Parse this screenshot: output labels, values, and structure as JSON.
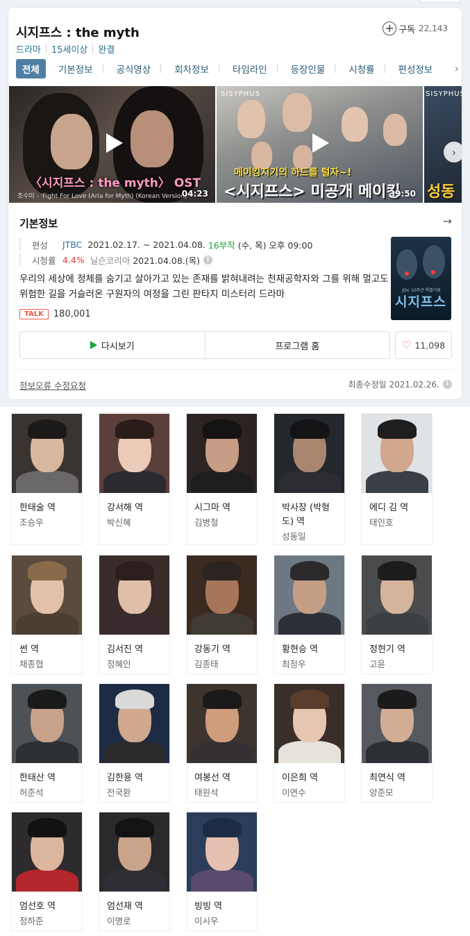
{
  "header": {
    "title": "시지프스 : the myth",
    "subscribe_label": "구독",
    "subscribe_count": "22,143",
    "meta": [
      "드라마",
      "15세이상",
      "완결"
    ]
  },
  "tabs": [
    "전체",
    "기본정보",
    "공식영상",
    "회차정보",
    "타임라인",
    "등장인물",
    "시청률",
    "편성정보"
  ],
  "videos": [
    {
      "caption": "〈시지프스 : the myth〉 OST",
      "subtitle": "조수미 - 'Fight For Love (Aria for Myth) (Korean Version)'",
      "duration": "04:23"
    },
    {
      "logo": "SISYPHUS",
      "caption_top": "메이킹지기의 하드를 털자~!",
      "caption_main": "<시지프스> 미공개 메이킹",
      "duration": "39:50"
    },
    {
      "logo": "SISYPHUS",
      "caption_main": "성동"
    }
  ],
  "basic_info": {
    "section_title": "기본정보",
    "broadcast_label": "편성",
    "channel": "JTBC",
    "period": "2021.02.17. ~ 2021.04.08.",
    "episodes": "16부작",
    "schedule": "(수, 목) 오후 09:00",
    "rating_label": "시청률",
    "rating": "4.4%",
    "rating_source": "닐슨코리아",
    "rating_date": "2021.04.08.(목)",
    "description": "우리의 세상에 정체를 숨기고 살아가고 있는 존재를 밝혀내려는 천재공학자와 그를 위해 멀고도 위험한 길을 거슬러온 구원자의 여정을 그린 판타지 미스터리 드라마",
    "talk_badge": "TALK",
    "talk_count": "180,001",
    "poster_title": "시지프스",
    "poster_small": "jtbc 10주년 특별기획"
  },
  "buttons": {
    "rewatch": "다시보기",
    "program_home": "프로그램 홈",
    "likes": "11,098"
  },
  "footer": {
    "report": "정보오류 수정요청",
    "updated": "최종수정일 2021.02.26."
  },
  "cast": [
    {
      "role": "한태술 역",
      "actor": "조승우"
    },
    {
      "role": "강서해 역",
      "actor": "박신혜"
    },
    {
      "role": "시그마 역",
      "actor": "김병철"
    },
    {
      "role": "박사장 (박형도) 역",
      "actor": "성동일"
    },
    {
      "role": "에디 김 역",
      "actor": "태인호"
    },
    {
      "role": "썬 역",
      "actor": "채종협"
    },
    {
      "role": "김서진 역",
      "actor": "정혜인"
    },
    {
      "role": "강동기 역",
      "actor": "김종태"
    },
    {
      "role": "황현승 역",
      "actor": "최정우"
    },
    {
      "role": "정현기 역",
      "actor": "고윤"
    },
    {
      "role": "한태산 역",
      "actor": "허준석"
    },
    {
      "role": "김한용 역",
      "actor": "전국환"
    },
    {
      "role": "여봉선 역",
      "actor": "태원석"
    },
    {
      "role": "이은희 역",
      "actor": "이연수"
    },
    {
      "role": "최연식 역",
      "actor": "양준모"
    },
    {
      "role": "엄선호 역",
      "actor": "정하준"
    },
    {
      "role": "엄선재 역",
      "actor": "이명로"
    },
    {
      "role": "빙빙 역",
      "actor": "이시우"
    }
  ]
}
